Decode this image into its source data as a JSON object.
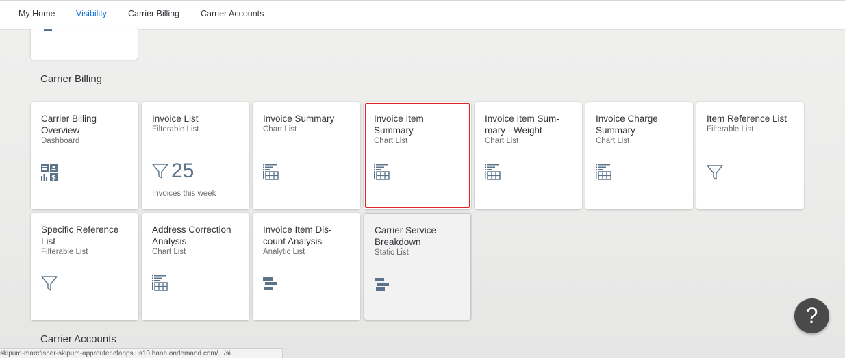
{
  "nav": {
    "tabs": [
      {
        "label": "My Home"
      },
      {
        "label": "Visibility"
      },
      {
        "label": "Carrier Billing"
      },
      {
        "label": "Carrier Accounts"
      }
    ],
    "active_tab": "Visibility"
  },
  "sections": {
    "carrier_billing": "Carrier Billing",
    "carrier_accounts": "Carrier Accounts"
  },
  "tiles": [
    {
      "title": "Carrier Billing Overview",
      "subtitle": "Dashboard",
      "icon": "dashboard-icon"
    },
    {
      "title": "Invoice List",
      "subtitle": "Filterable List",
      "icon": "filter-icon",
      "kpi_value": "25",
      "kpi_footer": "Invoices this week"
    },
    {
      "title": "Invoice Summary",
      "subtitle": "Chart List",
      "icon": "chart-table-icon"
    },
    {
      "title": "Invoice Item Summary",
      "subtitle": "Chart List",
      "icon": "chart-table-icon",
      "selected": true
    },
    {
      "title": "Invoice Item Sum-mary - Weight",
      "subtitle": "Chart List",
      "icon": "chart-table-icon"
    },
    {
      "title": "Invoice Charge Summary",
      "subtitle": "Chart List",
      "icon": "chart-table-icon"
    },
    {
      "title": "Item Reference List",
      "subtitle": "Filterable List",
      "icon": "filter-icon"
    },
    {
      "title": "Specific Reference List",
      "subtitle": "Filterable List",
      "icon": "filter-icon"
    },
    {
      "title": "Address Correction Analysis",
      "subtitle": "Chart List",
      "icon": "chart-table-icon"
    },
    {
      "title": "Invoice Item Dis-count Analysis",
      "subtitle": "Analytic List",
      "icon": "bar-chart-horizontal-icon"
    },
    {
      "title": "Carrier Service Breakdown",
      "subtitle": "Static List",
      "icon": "bar-chart-horizontal-icon",
      "hovered": true
    }
  ],
  "help": {
    "label": "?"
  },
  "status_bar": {
    "url": "skipum-marcfisher-skipum-approuter.cfapps.us10.hana.ondemand.com/.../si..."
  },
  "colors": {
    "accent": "#0a6ed1",
    "icon": "#5b738b",
    "selection": "#e02424"
  }
}
